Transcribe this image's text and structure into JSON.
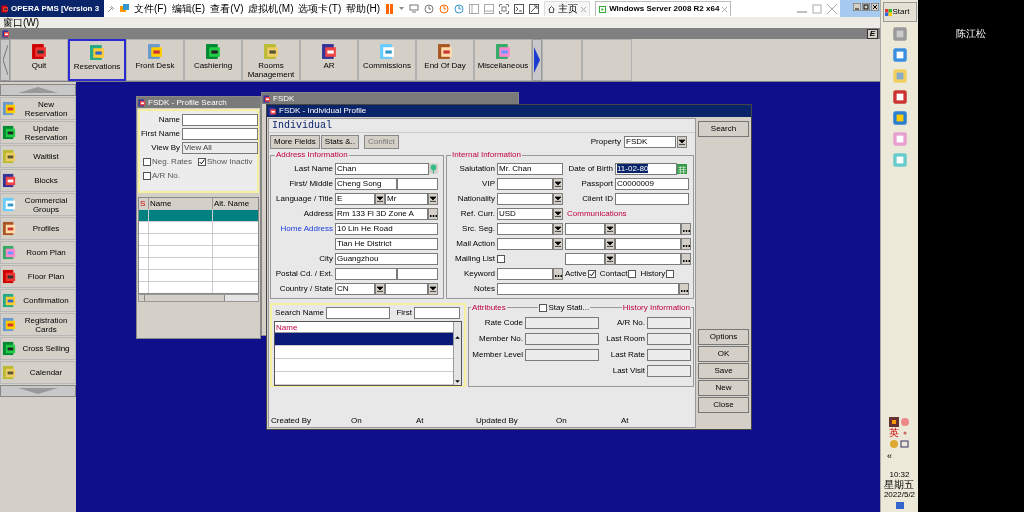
{
  "vm": {
    "app_title": "OPERA PMS [Version 3",
    "menu": [
      "文件(F)",
      "编辑(E)",
      "查看(V)",
      "虚拟机(M)",
      "选项卡(T)",
      "帮助(H)"
    ],
    "tabs": [
      {
        "label": "主页",
        "selected": false
      },
      {
        "label": "Windows Server 2008 R2 x64",
        "selected": true
      }
    ]
  },
  "app_menu": [
    "窗口(W)"
  ],
  "app_bar": {
    "button": "E"
  },
  "toolbar": [
    {
      "label": "Quit",
      "selected": false
    },
    {
      "label": "Reservations",
      "selected": true
    },
    {
      "label": "Front Desk",
      "selected": false
    },
    {
      "label": "Cashiering",
      "selected": false
    },
    {
      "label": "Rooms Management",
      "selected": false
    },
    {
      "label": "AR",
      "selected": false
    },
    {
      "label": "Commissions",
      "selected": false
    },
    {
      "label": "End Of Day",
      "selected": false
    },
    {
      "label": "Miscellaneous",
      "selected": false
    }
  ],
  "sidebar": [
    "New Reservation",
    "Update Reservation",
    "Waitlist",
    "Blocks",
    "Commercial Groups",
    "Profiles",
    "Room Plan",
    "Floor Plan",
    "Confirmation",
    "Registration Cards",
    "Cross Selling",
    "Calendar"
  ],
  "profile_search": {
    "title": "FSDK - Profile Search",
    "fields": [
      {
        "label": "Name"
      },
      {
        "label": "First Name"
      },
      {
        "label": "View By",
        "value": "View All"
      }
    ],
    "checkboxes": [
      {
        "label": "Neg. Rates",
        "checked": false
      },
      {
        "label": "Show Inactiv",
        "checked": true
      },
      {
        "label": "A/R No.",
        "checked": false
      }
    ],
    "columns": [
      "S",
      "Name",
      "Alt. Name"
    ],
    "rows": [
      {
        "selected": true
      },
      {
        "selected": false
      },
      {
        "selected": false
      },
      {
        "selected": false
      },
      {
        "selected": false
      },
      {
        "selected": false
      },
      {
        "selected": false
      }
    ]
  },
  "background_window": {
    "title": "FSDK"
  },
  "individual_profile": {
    "title": "FSDK - Individual Profile",
    "heading": "Individual",
    "buttons": [
      {
        "label": "More Fields",
        "disabled": false
      },
      {
        "label": "Stats &..",
        "disabled": false
      },
      {
        "label": "Conflict",
        "disabled": true
      }
    ],
    "property": {
      "label": "Property",
      "value": "FSDK"
    },
    "address": {
      "title": "Address Information",
      "fields": [
        {
          "kind": "lookup",
          "label": "Last Name",
          "value": "Chan"
        },
        {
          "kind": "text2",
          "label": "First/ Middle",
          "value": "Cheng Song"
        },
        {
          "kind": "combo2",
          "label": "Language / Title",
          "value": "E",
          "value2": "Mr"
        },
        {
          "kind": "more",
          "label": "Address",
          "value": "Rm 133 Fl 3D Zone A"
        },
        {
          "kind": "text",
          "label": "Home Address",
          "link": true,
          "value": "10 Lin He Road"
        },
        {
          "kind": "text",
          "value": "Tian He District"
        },
        {
          "kind": "text",
          "label": "City",
          "value": "Guangzhou"
        },
        {
          "kind": "text2",
          "label": "Postal Cd. / Ext."
        },
        {
          "kind": "combo2",
          "label": "Country / State",
          "value": "CN"
        }
      ]
    },
    "internal": {
      "title": "Internal Information",
      "fields": [
        {
          "kind": "text",
          "label": "Salutation",
          "value": "Mr. Chan"
        },
        {
          "kind": "combo",
          "label": "VIP"
        },
        {
          "kind": "combo",
          "label": "Nationality"
        },
        {
          "kind": "combo",
          "label": "Ref. Curr.",
          "value": "USD"
        },
        {
          "kind": "combo",
          "label": "Src. Seg."
        },
        {
          "kind": "combo",
          "label": "Mail Action"
        },
        {
          "kind": "check",
          "label": "Mailing List",
          "checked": false
        },
        {
          "kind": "more",
          "label": "Keyword"
        }
      ],
      "date_of_birth": {
        "label": "Date of Birth",
        "value": "11-02-80",
        "selected": true
      },
      "passport": {
        "label": "Passport",
        "value": "C0000009"
      },
      "client_id": {
        "label": "Client ID"
      },
      "communications_title": "Communications",
      "flags": [
        {
          "label": "Active",
          "checked": true
        },
        {
          "label": "Contact",
          "checked": false
        },
        {
          "label": "History",
          "checked": false
        }
      ],
      "notes_label": "Notes"
    },
    "search": {
      "name_label": "Search Name",
      "first_label": "First",
      "column": "Name",
      "rows": [
        {
          "selected": true
        },
        {
          "selected": false
        },
        {
          "selected": false
        },
        {
          "selected": false
        }
      ]
    },
    "attributes": {
      "title": "Attributes",
      "stay_stats": {
        "label": "Stay Stati...",
        "checked": false
      },
      "history_title": "History Information",
      "left": [
        "Rate Code",
        "Member No.",
        "Member Level"
      ],
      "right": [
        "A/R No.",
        "Last Room",
        "Last Rate",
        "Last Visit"
      ]
    },
    "side_buttons": [
      "Search",
      "Options",
      "OK",
      "Save",
      "New",
      "Close"
    ],
    "status": [
      "Created By",
      "On",
      "At",
      "Updated By",
      "On",
      "At"
    ]
  },
  "taskbar": {
    "start": "Start",
    "tray": "英",
    "more": "«",
    "time": "10:32",
    "weekday": "星期五",
    "date": "2022/5/2"
  },
  "user_name": "陈江松"
}
